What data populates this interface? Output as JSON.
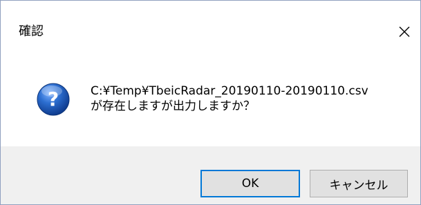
{
  "dialog": {
    "title": "確認",
    "message_line1": "C:¥Temp¥TbeicRadar_20190110-20190110.csv",
    "message_line2": "が存在しますが出力しますか？",
    "ok_label": "OK",
    "cancel_label": "キャンセル",
    "icon": "question-icon",
    "close_icon": "close-icon"
  },
  "colors": {
    "footer_bg": "#f0f0f0",
    "button_bg": "#e1e1e1",
    "focus_border": "#0078d7",
    "icon_blue": "#1f5fbf"
  }
}
